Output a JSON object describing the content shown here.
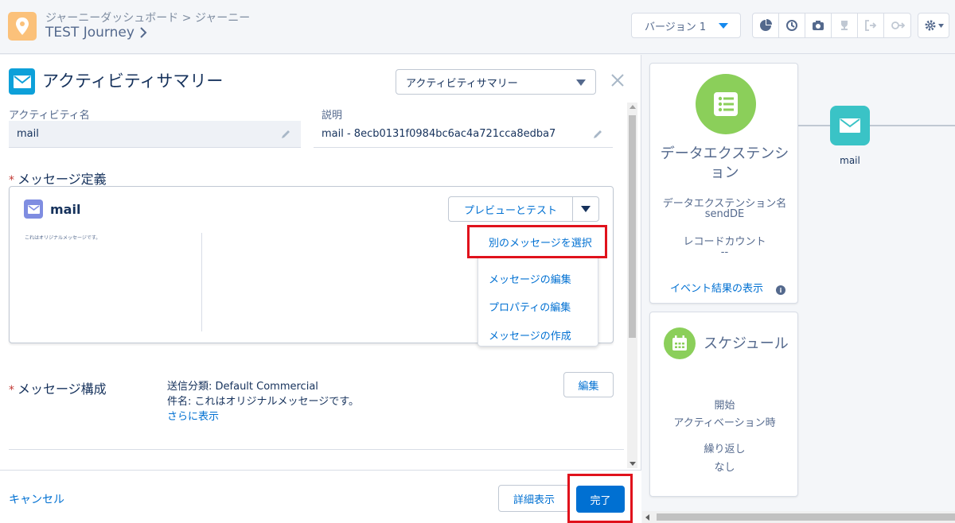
{
  "header": {
    "breadcrumb_link": "ジャーニーダッシュボード",
    "breadcrumb_sep": ">",
    "breadcrumb_current": "ジャーニー",
    "journey_name": "TEST Journey",
    "version_label": "バージョン 1",
    "toolbar_icons": [
      "pie-chart-icon",
      "history-icon",
      "camera-icon",
      "trophy-icon",
      "exit-icon",
      "settings-flow-icon"
    ]
  },
  "panel": {
    "title": "アクティビティサマリー",
    "activity_select_value": "アクティビティサマリー",
    "activity_name_label": "アクティビティ名",
    "activity_name_value": "mail",
    "description_label": "説明",
    "description_value": "mail - 8ecb0131f0984bc6ac4a721cca8edba7",
    "message_def_label": "メッセージ定義",
    "message": {
      "name": "mail",
      "preview_button": "プレビューとテスト",
      "thumbnail_text": "これはオリジナルメッセージです。"
    },
    "dropdown": {
      "items": [
        "別のメッセージを選択",
        "メッセージの編集",
        "プロパティの編集",
        "メッセージの作成"
      ]
    },
    "compose": {
      "label": "メッセージ構成",
      "send_class": "送信分類:  Default Commercial",
      "subject": "件名:  これはオリジナルメッセージです。",
      "show_more": "さらに表示",
      "edit_button": "編集"
    },
    "footer": {
      "cancel": "キャンセル",
      "detail": "詳細表示",
      "done": "完了"
    }
  },
  "canvas": {
    "de_card": {
      "title": "データエクステンション",
      "name_label": "データエクステンション名",
      "name_value": "sendDE",
      "count_label": "レコードカウント",
      "count_value": "--",
      "event_link": "イベント結果の表示",
      "info": "i"
    },
    "mail_node": {
      "label": "mail"
    },
    "schedule": {
      "title": "スケジュール",
      "start_label": "開始",
      "start_value": "アクティベーション時",
      "repeat_label": "繰り返し",
      "repeat_value": "なし"
    }
  },
  "colors": {
    "accent": "#0070d2",
    "highlight": "#e0121c",
    "de_icon": "#8bcf5a",
    "mail_node": "#3ac3c6",
    "email_icon": "#0da0d9"
  }
}
